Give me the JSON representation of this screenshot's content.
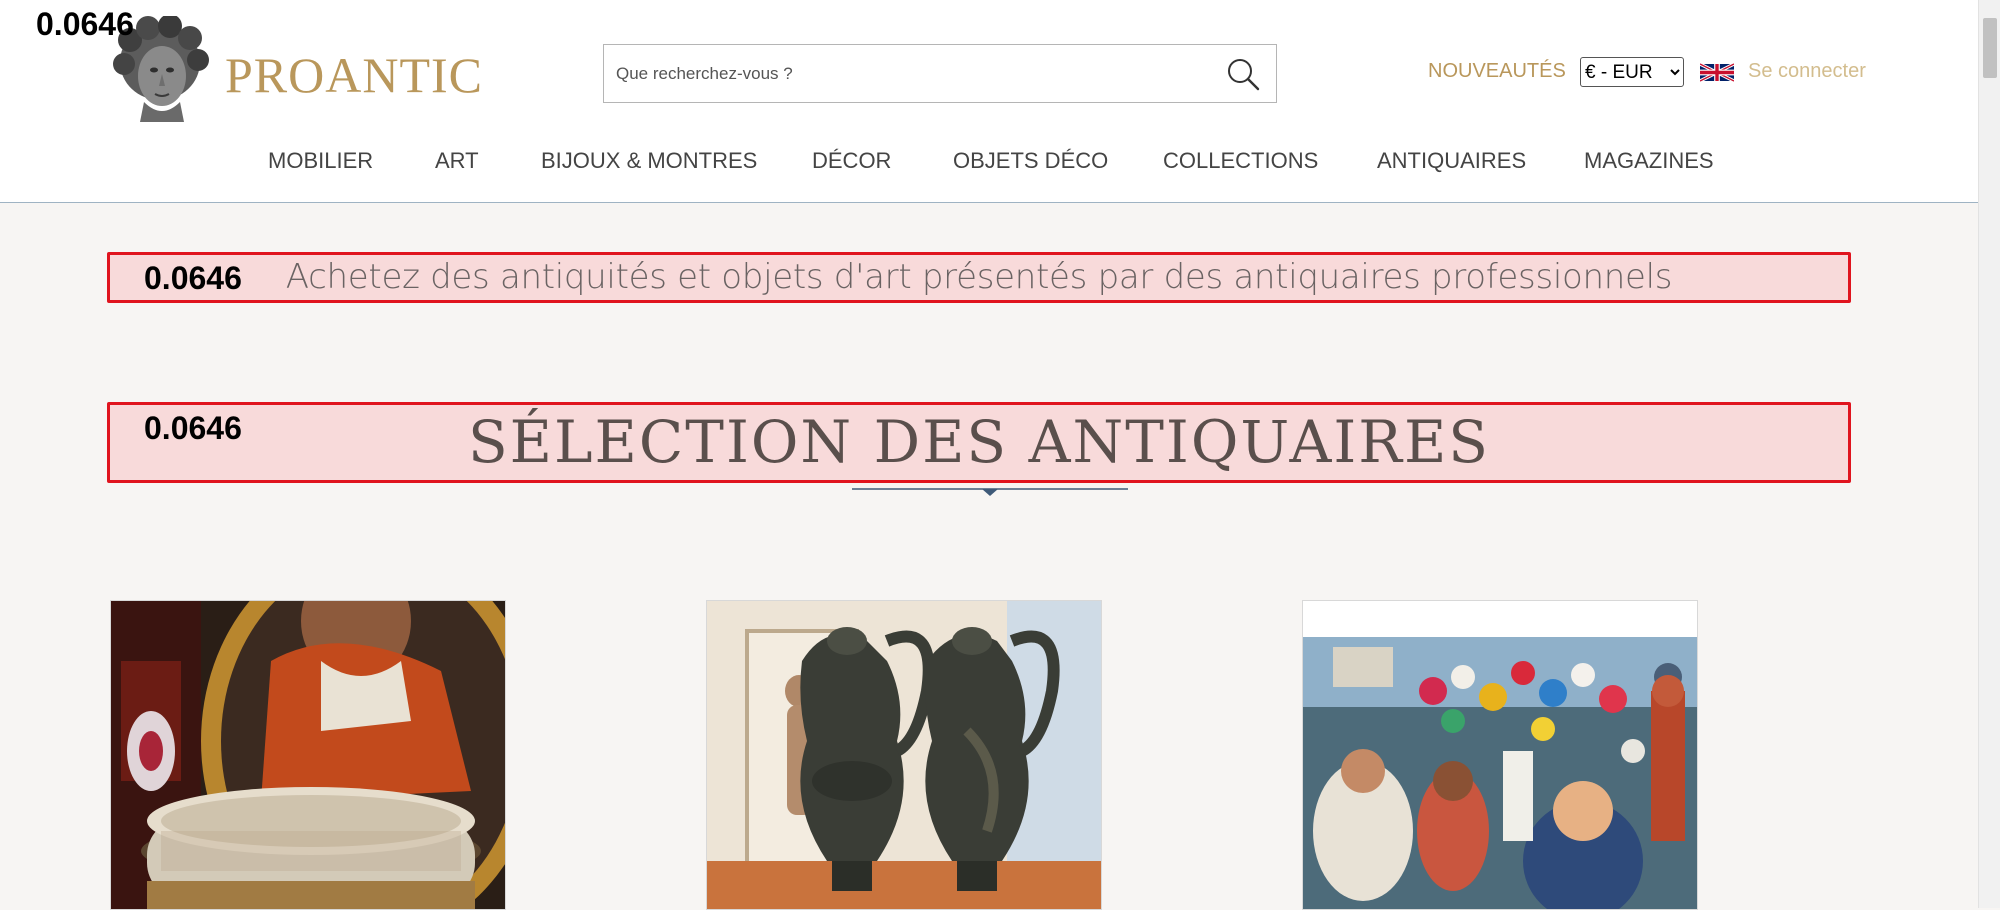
{
  "overlay": {
    "score": "0.0646"
  },
  "header": {
    "logo_text": "PROANTIC",
    "search_placeholder": "Que recherchez-vous ?",
    "nouveautes": "NOUVEAUTÉS",
    "currency": {
      "selected": "€ - EUR",
      "options": [
        "€ - EUR"
      ]
    },
    "login": "Se connecter"
  },
  "nav": {
    "items": [
      "MOBILIER",
      "ART",
      "BIJOUX & MONTRES",
      "DÉCOR",
      "OBJETS DÉCO",
      "COLLECTIONS",
      "ANTIQUAIRES",
      "MAGAZINES"
    ]
  },
  "main": {
    "tagline": "Achetez des antiquités et objets d'art présentés par des antiquaires professionnels",
    "section_title": "SÉLECTION DES ANTIQUAIRES",
    "products": [
      {
        "image": "upholstered-stool-with-portrait"
      },
      {
        "image": "pair-of-bronze-ewers"
      },
      {
        "image": "colorful-figurative-painting"
      }
    ]
  },
  "colors": {
    "gold": "#b9975b",
    "gold_light": "#d3bd8e",
    "highlight_fill": "#f8dada",
    "highlight_border": "#e0141e",
    "background": "#f7f5f3"
  }
}
